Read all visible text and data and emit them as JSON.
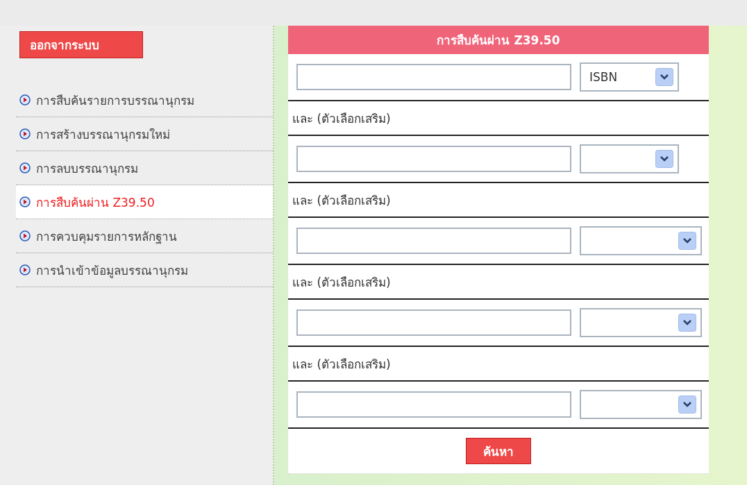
{
  "sidebar": {
    "logout_button": "ออกจากระบบ",
    "items": [
      {
        "label": "การสืบค้นรายการบรรณานุกรม",
        "selected": false
      },
      {
        "label": "การสร้างบรรณานุกรมใหม่",
        "selected": false
      },
      {
        "label": "การลบบรรณานุกรม",
        "selected": false
      },
      {
        "label": "การสืบค้นผ่าน Z39.50",
        "selected": true
      },
      {
        "label": "การควบคุมรายการหลักฐาน",
        "selected": false
      },
      {
        "label": "การนำเข้าข้อมูลบรรณานุกรม",
        "selected": false
      }
    ]
  },
  "panel": {
    "title": "การสืบค้นผ่าน Z39.50",
    "first_row": {
      "select_value": "ISBN"
    },
    "optional_rows": [
      {
        "label": "และ (ตัวเลือกเสริม)"
      },
      {
        "label": "และ (ตัวเลือกเสริม)"
      },
      {
        "label": "และ (ตัวเลือกเสริม)"
      },
      {
        "label": "และ (ตัวเลือกเสริม)"
      }
    ],
    "search_button": "ค้นหา"
  }
}
